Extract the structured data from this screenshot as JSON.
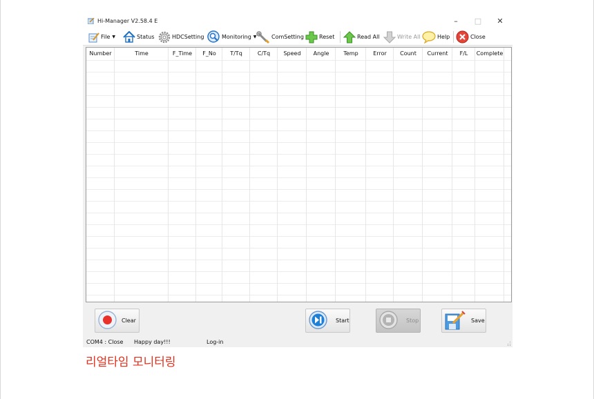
{
  "window": {
    "title": "Hi-Manager  V2.58.4 E",
    "controls": {
      "minimize": "–",
      "maximize": "□",
      "close": "✕"
    }
  },
  "toolbar": {
    "file": "File",
    "status": "Status",
    "hdc_setting": "HDCSetting",
    "monitoring": "Monitoring",
    "com_setting": "ComSetting",
    "reset": "Reset",
    "read_all": "Read All",
    "write_all": "Write All",
    "help": "Help",
    "close": "Close"
  },
  "table": {
    "columns": [
      "Number",
      "Time",
      "F_Time",
      "F_No",
      "T/Tq",
      "C/Tq",
      "Speed",
      "Angle",
      "Temp",
      "Error",
      "Count",
      "Current",
      "F/L",
      "Complete"
    ],
    "rows": []
  },
  "buttons": {
    "clear": "Clear",
    "start": "Start",
    "stop": "Stop",
    "save": "Save"
  },
  "status": {
    "port": "COM4 : Close",
    "message": "Happy day!!!",
    "login": "Log-in"
  },
  "caption": "리얼타임 모니터링",
  "colors": {
    "caption": "#e0301e",
    "record_red": "#e8322b",
    "play_blue": "#1e7fd6"
  },
  "icons": {
    "file": "file-edit-icon",
    "status": "home-icon",
    "hdc_setting": "gear-icon",
    "monitoring": "magnifier-icon",
    "com_setting": "wrench-icon",
    "reset": "plus-icon",
    "read_all": "arrow-up-icon",
    "write_all": "arrow-down-icon",
    "help": "speech-bubble-icon",
    "close": "close-circle-icon"
  }
}
